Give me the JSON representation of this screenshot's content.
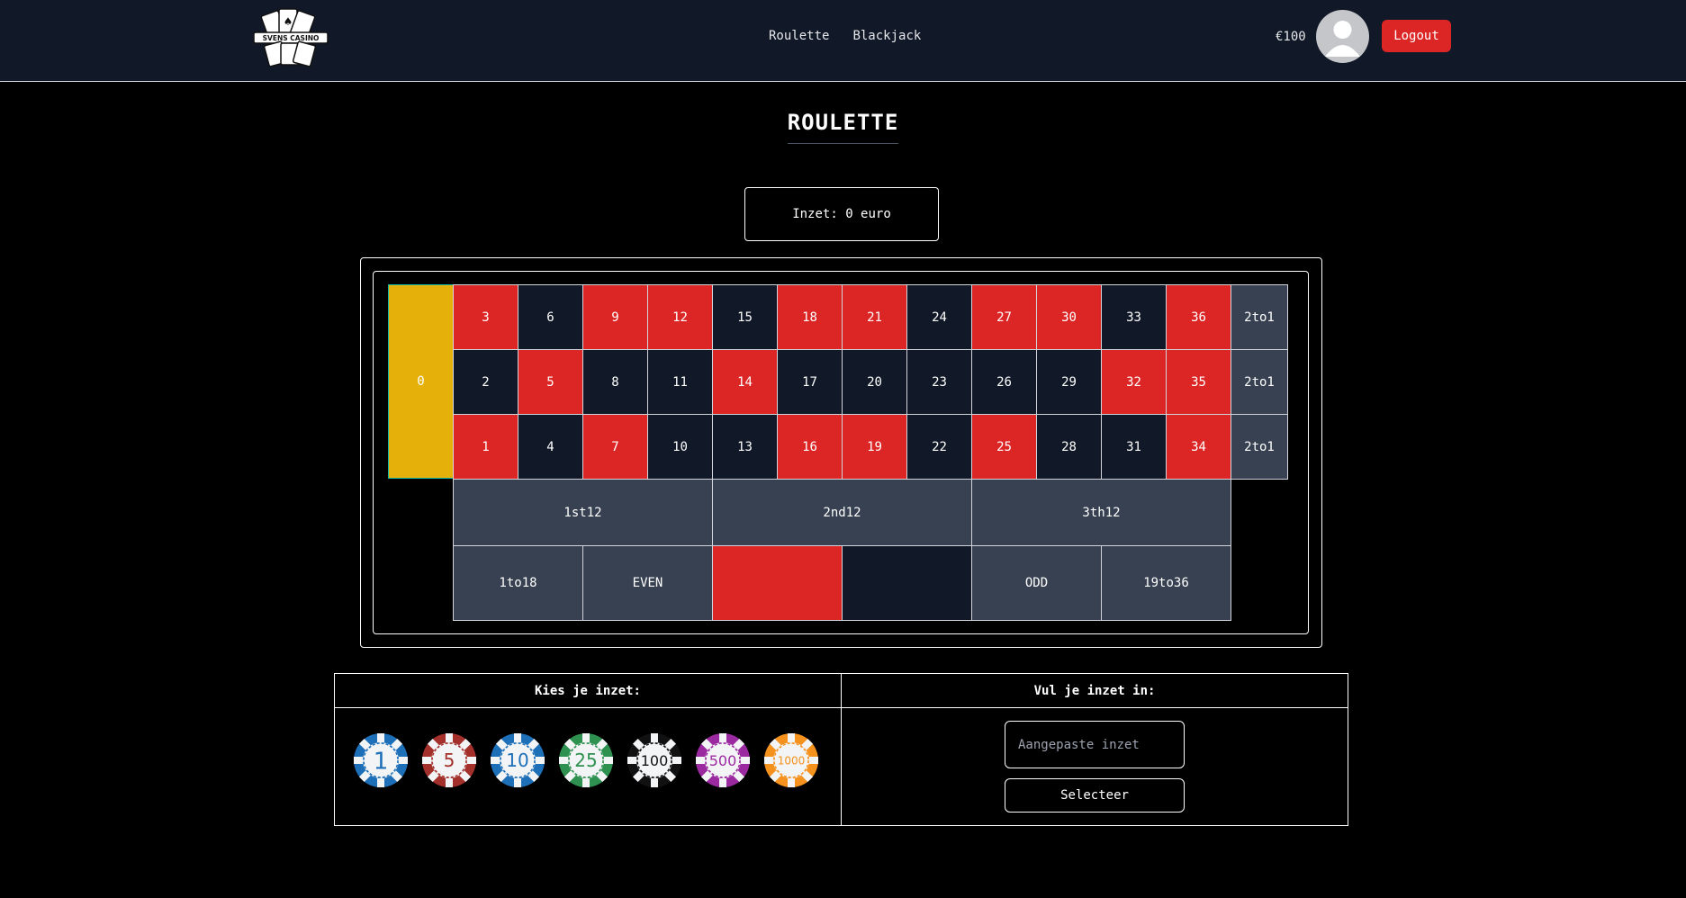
{
  "header": {
    "logo_text": "SVENS CASINO",
    "nav": [
      "Roulette",
      "Blackjack"
    ],
    "balance": "€100",
    "logout_label": "Logout"
  },
  "page_title": "ROULETTE",
  "stake": "Inzet: 0 euro",
  "board": {
    "zero": "0",
    "row_top": [
      "3",
      "6",
      "9",
      "12",
      "15",
      "18",
      "21",
      "24",
      "27",
      "30",
      "33",
      "36"
    ],
    "row_mid": [
      "2",
      "5",
      "8",
      "11",
      "14",
      "17",
      "20",
      "23",
      "26",
      "29",
      "32",
      "35"
    ],
    "row_bot": [
      "1",
      "4",
      "7",
      "10",
      "13",
      "16",
      "19",
      "22",
      "25",
      "28",
      "31",
      "34"
    ],
    "row_top_colors": [
      "red",
      "black",
      "red",
      "red",
      "black",
      "red",
      "red",
      "black",
      "red",
      "red",
      "black",
      "red"
    ],
    "row_mid_colors": [
      "black",
      "red",
      "black",
      "black",
      "red",
      "black",
      "black",
      "black",
      "black",
      "black",
      "red",
      "red"
    ],
    "row_bot_colors": [
      "red",
      "black",
      "red",
      "black",
      "black",
      "red",
      "red",
      "black",
      "red",
      "black",
      "black",
      "red"
    ],
    "column_bets": [
      "2to1",
      "2to1",
      "2to1"
    ],
    "dozens": [
      "1st12",
      "2nd12",
      "3th12"
    ],
    "outside": [
      {
        "label": "1to18",
        "color": "grey"
      },
      {
        "label": "EVEN",
        "color": "grey"
      },
      {
        "label": "",
        "color": "red"
      },
      {
        "label": "",
        "color": "black"
      },
      {
        "label": "ODD",
        "color": "grey"
      },
      {
        "label": "19to36",
        "color": "grey"
      }
    ]
  },
  "bet_panel": {
    "choose_heading": "Kies je inzet:",
    "custom_heading": "Vul je inzet in:",
    "chips": [
      {
        "value": "1",
        "color": "#1d6fb8"
      },
      {
        "value": "5",
        "color": "#a3302b"
      },
      {
        "value": "10",
        "color": "#1d6fb8"
      },
      {
        "value": "25",
        "color": "#2e9150"
      },
      {
        "value": "100",
        "color": "#111111"
      },
      {
        "value": "500",
        "color": "#9b2aa0"
      },
      {
        "value": "1000",
        "color": "#f5921e"
      }
    ],
    "custom_placeholder": "Aangepaste inzet",
    "select_label": "Selecteer"
  },
  "colors": {
    "red": "#dc2626",
    "black": "#111827",
    "grey": "#374151",
    "zero": "#e6b00a",
    "header": "#111827"
  }
}
